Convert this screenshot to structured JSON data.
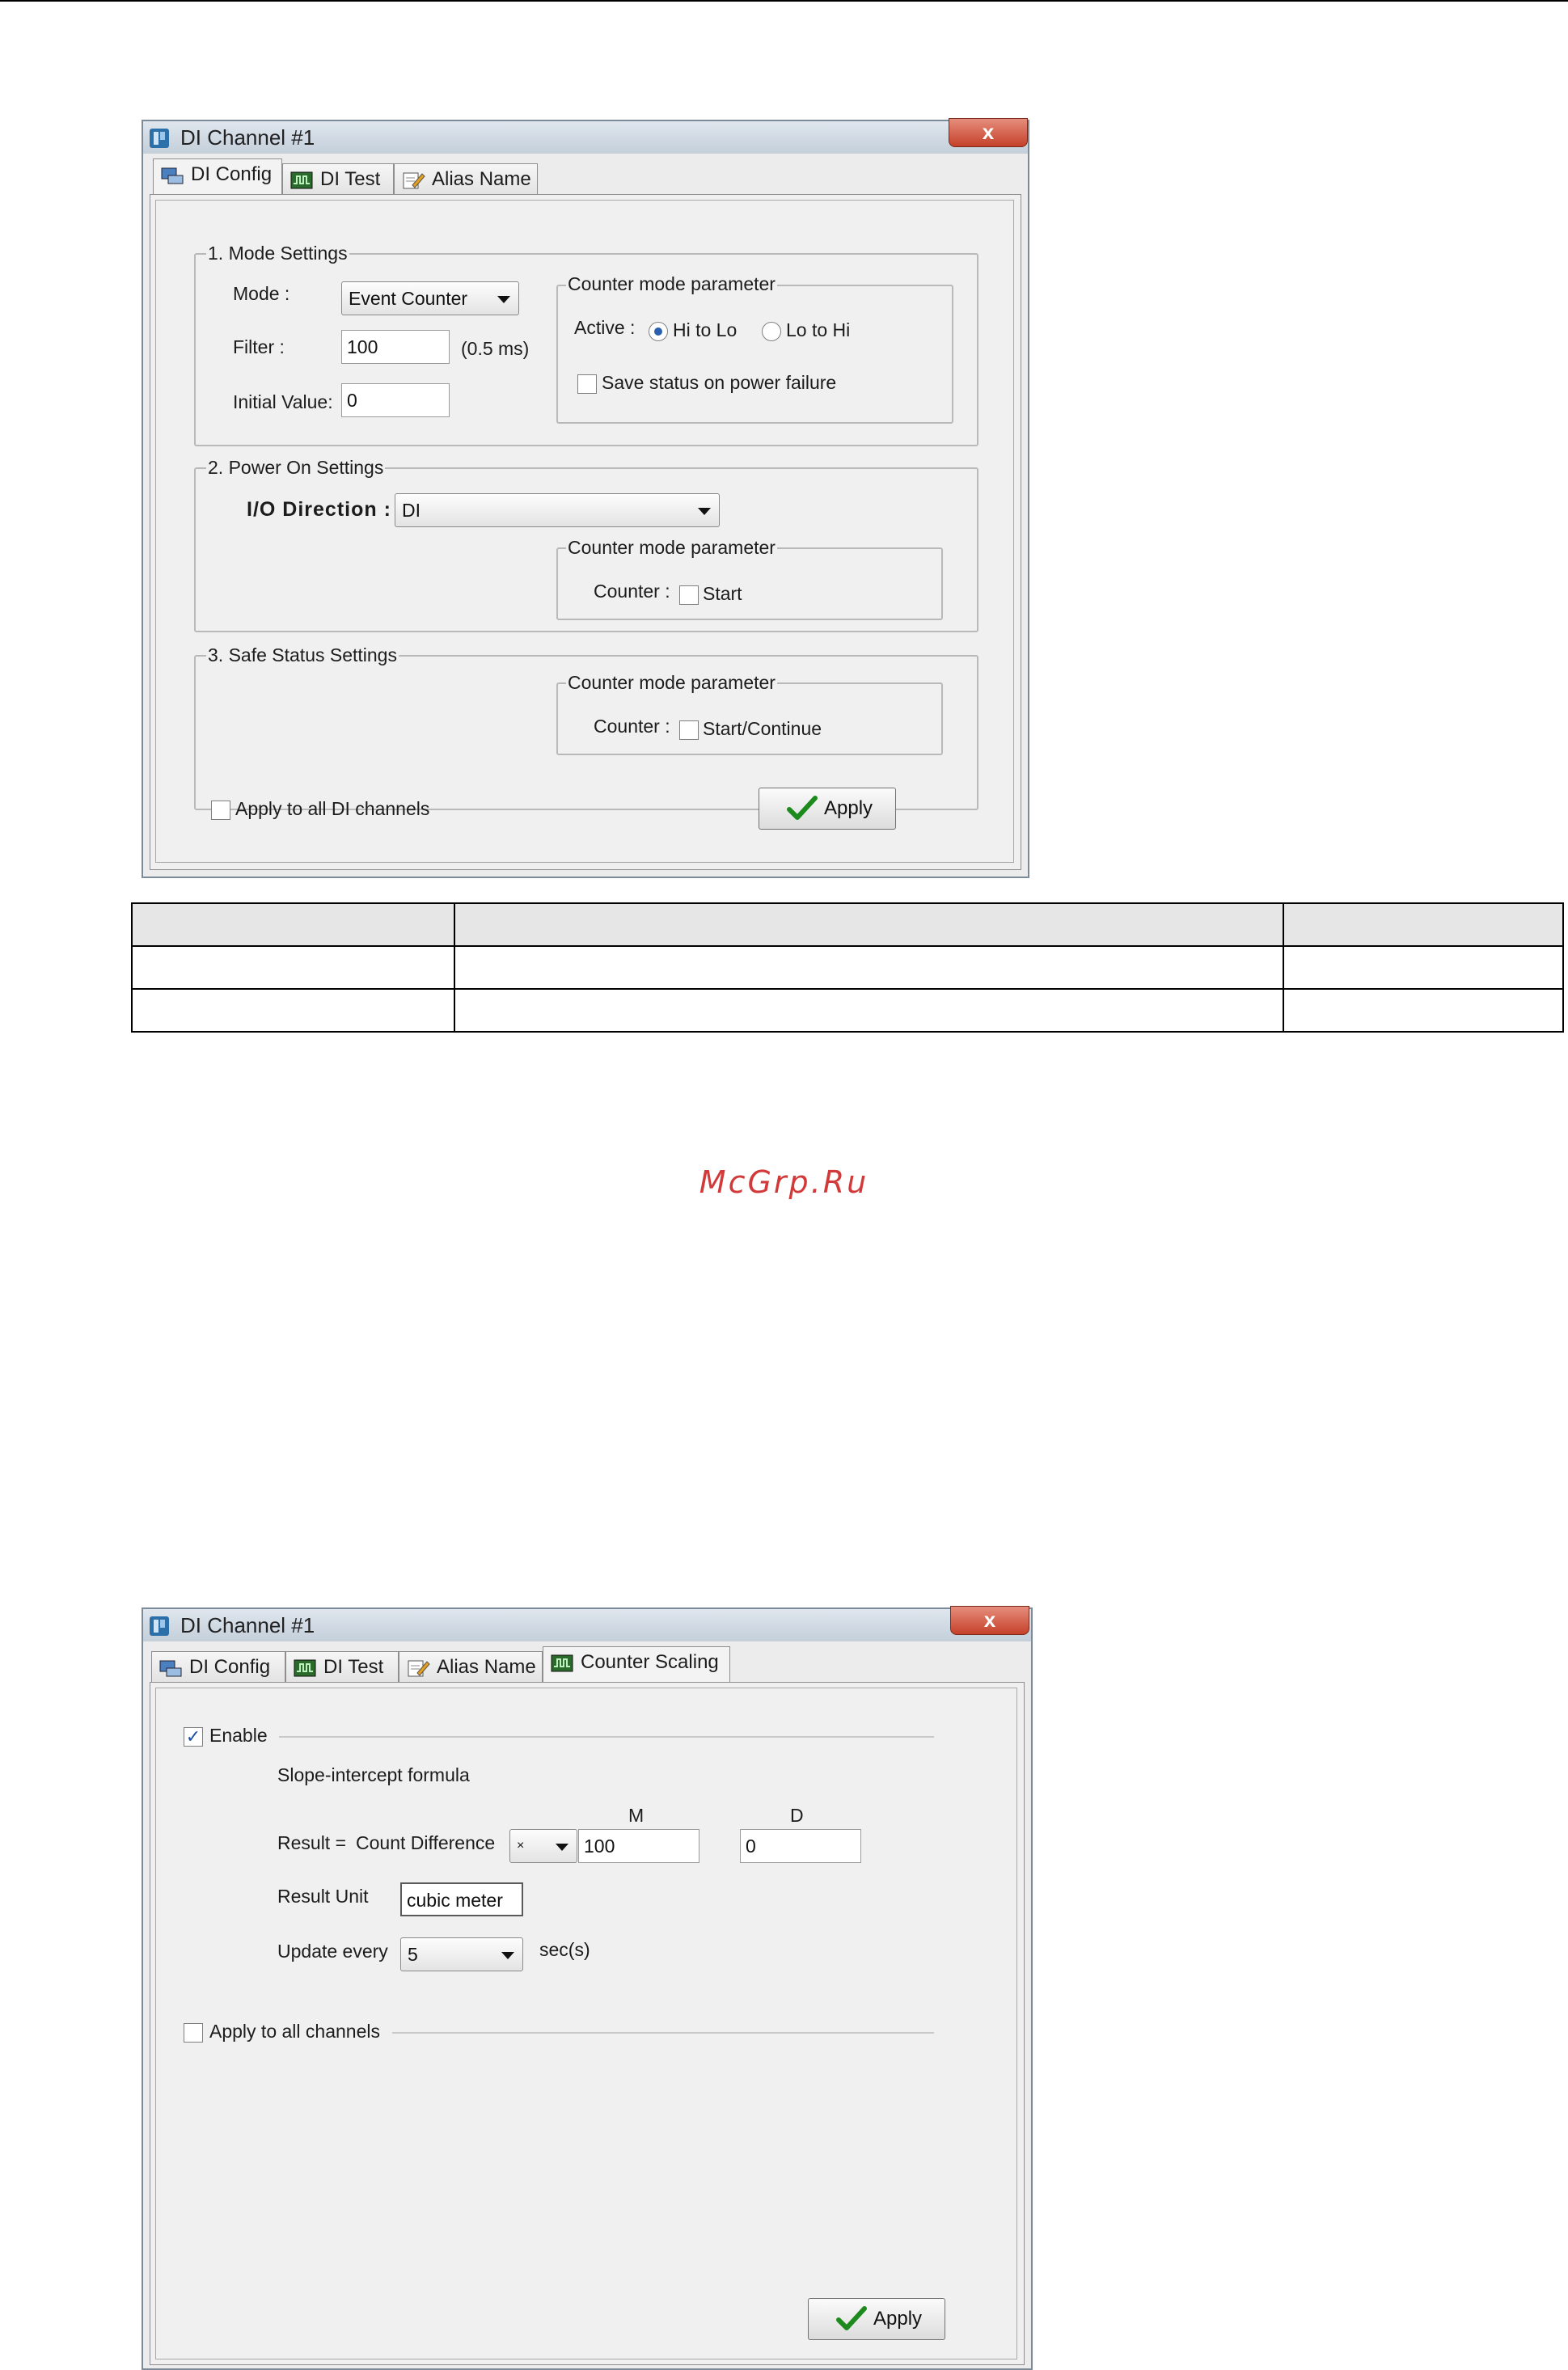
{
  "dialog1": {
    "title": "DI Channel #1",
    "close": "x",
    "tabs": [
      {
        "label": "DI Config"
      },
      {
        "label": "DI Test"
      },
      {
        "label": "Alias Name"
      }
    ],
    "mode_settings": {
      "legend": "1. Mode Settings",
      "mode_label": "Mode :",
      "mode_value": "Event Counter",
      "filter_label": "Filter :",
      "filter_value": "100",
      "filter_unit": "(0.5 ms)",
      "initial_label": "Initial Value:",
      "initial_value": "0",
      "counter_param": {
        "legend": "Counter mode parameter",
        "active_label": "Active :",
        "hi_to_lo": "Hi to Lo",
        "lo_to_hi": "Lo to Hi",
        "active_selected": "Hi to Lo",
        "save_status": "Save status on power failure",
        "save_status_checked": false
      }
    },
    "power_on": {
      "legend": "2. Power On Settings",
      "io_label": "I/O Direction :",
      "io_value": "DI",
      "counter_param": {
        "legend": "Counter mode parameter",
        "counter_label": "Counter :",
        "start": "Start",
        "start_checked": false
      }
    },
    "safe_status": {
      "legend": "3. Safe Status Settings",
      "counter_param": {
        "legend": "Counter mode parameter",
        "counter_label": "Counter :",
        "start_continue": "Start/Continue",
        "checked": false
      }
    },
    "apply_all": "Apply to all DI channels",
    "apply_all_checked": false,
    "apply": "Apply"
  },
  "watermark": "McGrp.Ru",
  "dialog2": {
    "title": "DI Channel #1",
    "close": "x",
    "tabs": [
      {
        "label": "DI Config"
      },
      {
        "label": "DI Test"
      },
      {
        "label": "Alias Name"
      },
      {
        "label": "Counter Scaling"
      }
    ],
    "enable_label": "Enable",
    "enable_checked": true,
    "formula_label": "Slope-intercept formula",
    "m_header": "M",
    "d_header": "D",
    "result_label": "Result =",
    "count_diff": "Count Difference",
    "operator": "×",
    "m_value": "100",
    "d_value": "0",
    "unit_label": "Result Unit",
    "unit_value": "cubic meter",
    "update_label": "Update every",
    "update_value": "5",
    "update_unit": "sec(s)",
    "apply_all": "Apply to all channels",
    "apply_all_checked": false,
    "apply": "Apply"
  },
  "colors": {
    "titlebar": "#c4cfda",
    "close": "#c5412a",
    "check_green": "#1d8a1d",
    "watermark": "#d23a3a"
  }
}
